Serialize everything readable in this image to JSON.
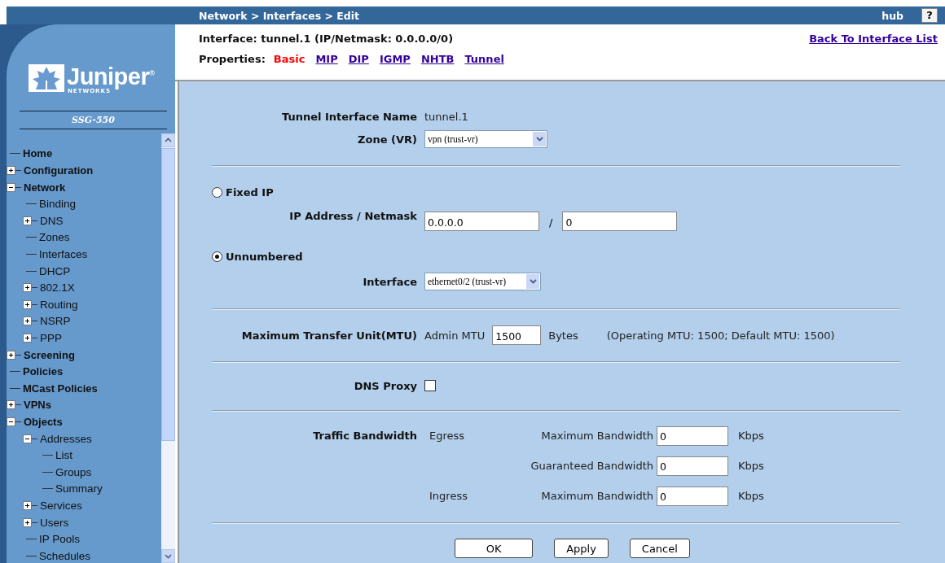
{
  "breadcrumb": "Network > Interfaces > Edit",
  "user": "hub",
  "help": "?",
  "sidebar": {
    "logo": {
      "name": "Juniper",
      "mark": "®",
      "sub": "NETWORKS"
    },
    "device": "SSG-550",
    "tree": [
      {
        "label": "Home",
        "kind": "leaf"
      },
      {
        "label": "Configuration",
        "kind": "folder",
        "expanded": false
      },
      {
        "label": "Network",
        "kind": "folder",
        "expanded": true,
        "children": [
          {
            "label": "Binding",
            "kind": "leaf"
          },
          {
            "label": "DNS",
            "kind": "folder",
            "expanded": false
          },
          {
            "label": "Zones",
            "kind": "leaf"
          },
          {
            "label": "Interfaces",
            "kind": "leaf"
          },
          {
            "label": "DHCP",
            "kind": "leaf"
          },
          {
            "label": "802.1X",
            "kind": "folder",
            "expanded": false
          },
          {
            "label": "Routing",
            "kind": "folder",
            "expanded": false
          },
          {
            "label": "NSRP",
            "kind": "folder",
            "expanded": false
          },
          {
            "label": "PPP",
            "kind": "folder",
            "expanded": false
          }
        ]
      },
      {
        "label": "Screening",
        "kind": "folder",
        "expanded": false
      },
      {
        "label": "Policies",
        "kind": "leaf"
      },
      {
        "label": "MCast Policies",
        "kind": "leaf"
      },
      {
        "label": "VPNs",
        "kind": "folder",
        "expanded": false
      },
      {
        "label": "Objects",
        "kind": "folder",
        "expanded": true,
        "children": [
          {
            "label": "Addresses",
            "kind": "folder",
            "expanded": true,
            "children": [
              {
                "label": "List",
                "kind": "leaf"
              },
              {
                "label": "Groups",
                "kind": "leaf"
              },
              {
                "label": "Summary",
                "kind": "leaf"
              }
            ]
          },
          {
            "label": "Services",
            "kind": "folder",
            "expanded": false
          },
          {
            "label": "Users",
            "kind": "folder",
            "expanded": false
          },
          {
            "label": "IP Pools",
            "kind": "leaf"
          },
          {
            "label": "Schedules",
            "kind": "leaf"
          }
        ]
      }
    ]
  },
  "header": {
    "title": "Interface: tunnel.1 (IP/Netmask: 0.0.0.0/0)",
    "back_link": "Back To Interface List",
    "properties_label": "Properties:",
    "tabs": [
      {
        "label": "Basic",
        "selected": true
      },
      {
        "label": "MIP",
        "selected": false
      },
      {
        "label": "DIP",
        "selected": false
      },
      {
        "label": "IGMP",
        "selected": false
      },
      {
        "label": "NHTB",
        "selected": false
      },
      {
        "label": "Tunnel",
        "selected": false
      }
    ]
  },
  "form": {
    "name_label": "Tunnel Interface Name",
    "name_value": "tunnel.1",
    "zone_label": "Zone (VR)",
    "zone_value": "vpn (trust-vr)",
    "ip_modes": [
      {
        "label": "Fixed IP",
        "selected": false
      },
      {
        "label": "Unnumbered",
        "selected": true
      }
    ],
    "ip_label": "IP Address / Netmask",
    "ip_value": "0.0.0.0",
    "slash": "/",
    "netmask_value": "0",
    "interface_label": "Interface",
    "interface_value": "ethernet0/2 (trust-vr)",
    "mtu": {
      "label": "Maximum Transfer Unit(MTU)",
      "admin_label": "Admin MTU",
      "value": "1500",
      "unit": "Bytes",
      "note": "(Operating MTU: 1500; Default MTU: 1500)"
    },
    "dns_proxy": {
      "label": "DNS Proxy",
      "checked": false
    },
    "bandwidth": {
      "label": "Traffic Bandwidth",
      "rows": [
        {
          "direction": "Egress",
          "label": "Maximum Bandwidth",
          "value": "0",
          "unit": "Kbps"
        },
        {
          "label": "Guaranteed Bandwidth",
          "value": "0",
          "unit": "Kbps"
        },
        {
          "direction": "Ingress",
          "label": "Maximum Bandwidth",
          "value": "0",
          "unit": "Kbps"
        }
      ]
    },
    "buttons": [
      "OK",
      "Apply",
      "Cancel"
    ]
  }
}
